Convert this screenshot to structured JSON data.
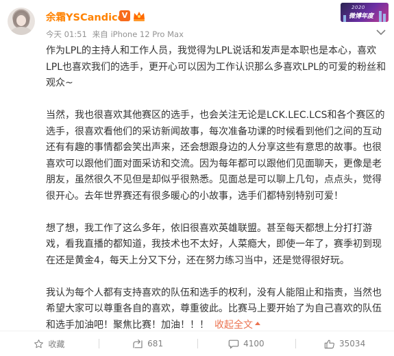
{
  "header": {
    "username": "余霜YSCandice",
    "vip_mark": "V",
    "meta_time": "今天 01:51",
    "meta_source": "来自 iPhone 12 Pro Max",
    "decor_line1": "2020",
    "decor_line2": "微博年度"
  },
  "post": {
    "paragraphs": [
      "作为LPL的主持人和工作人员，我觉得为LPL说话和发声是本职也是本心，喜欢LPL也喜欢我们的选手，更开心可以因为工作认识那么多喜欢LPL的可爱的粉丝和观众~",
      "当然，我也很喜欢其他赛区的选手，也会关注无论是LCK.LEC.LCS和各个赛区的选手，很喜欢看他们的采访新闻故事，每次准备功课的时候看到他们之间的互动还有有趣的事情都会笑出声来，还会想跟身边的人分享这些有意思的故事。也很喜欢可以跟他们面对面采访和交流。因为每年都可以跟他们见面聊天，更像是老朋友，虽然很久不见但是却似乎很熟悉。见面总是可以聊上几句，点点头，觉得很开心。去年世界赛还有很多暖心的小故事，选手们都特别特别可爱！",
      "想了想，我工作了这么多年，依旧很喜欢英雄联盟。甚至每天都想上分打打游戏，看我直播的都知道，我技术也不太好，人菜瘾大，即使一年了，赛季初到现在还是黄金4，每天上分又下分，还在努力练习当中，还是觉得很好玩。",
      "我认为每个人都有支持喜欢的队伍和选手的权利，没有人能阻止和指责，当然也希望大家可以尊重各自的喜欢，尊重彼此。比赛马上要开始了为自己喜欢的队伍和选手加油吧！聚焦比赛！加油！！！"
    ],
    "collapse_label": "收起全文"
  },
  "actions": {
    "favorite_label": "收藏",
    "repost_count": "681",
    "comment_count": "4100",
    "like_count": "35034"
  },
  "colors": {
    "username": "#ff8200",
    "link": "#eb7350",
    "meta": "#939393",
    "text": "#333333"
  }
}
